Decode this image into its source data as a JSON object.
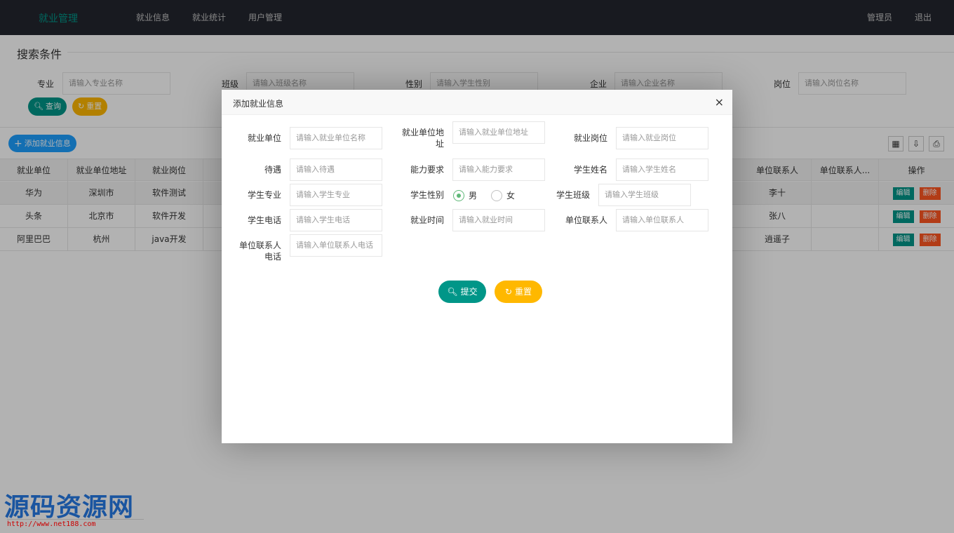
{
  "header": {
    "logo": "就业管理",
    "nav": [
      "就业信息",
      "就业统计",
      "用户管理"
    ],
    "right": [
      "管理员",
      "退出"
    ]
  },
  "search": {
    "legend": "搜索条件",
    "fields": [
      {
        "label": "专业",
        "placeholder": "请输入专业名称"
      },
      {
        "label": "班级",
        "placeholder": "请输入班级名称"
      },
      {
        "label": "性别",
        "placeholder": "请输入学生性别"
      },
      {
        "label": "企业",
        "placeholder": "请输入企业名称"
      },
      {
        "label": "岗位",
        "placeholder": "请输入岗位名称"
      }
    ],
    "query_label": "查询",
    "reset_label": "重置"
  },
  "toolbar": {
    "add_label": "添加就业信息"
  },
  "table": {
    "headers_left": [
      "就业单位",
      "就业单位地址",
      "就业岗位"
    ],
    "headers_right": [
      "单位联系人",
      "单位联系人...",
      "操作"
    ],
    "rows": [
      {
        "unit": "华为",
        "address": "深圳市",
        "position": "软件测试",
        "contact": "李十"
      },
      {
        "unit": "头条",
        "address": "北京市",
        "position": "软件开发",
        "contact": "张八"
      },
      {
        "unit": "阿里巴巴",
        "address": "杭州",
        "position": "java开发",
        "contact": "逍遥子"
      }
    ],
    "edit_label": "编辑",
    "delete_label": "删除"
  },
  "modal": {
    "title": "添加就业信息",
    "close": "×",
    "fields": {
      "unit": {
        "label": "就业单位",
        "placeholder": "请输入就业单位名称"
      },
      "address_label_1": "就业单位地",
      "address_label_2": "址",
      "address": {
        "placeholder": "请输入就业单位地址"
      },
      "position": {
        "label": "就业岗位",
        "placeholder": "请输入就业岗位"
      },
      "salary": {
        "label": "待遇",
        "placeholder": "请输入待遇"
      },
      "ability": {
        "label": "能力要求",
        "placeholder": "请输入能力要求"
      },
      "name": {
        "label": "学生姓名",
        "placeholder": "请输入学生姓名"
      },
      "major": {
        "label": "学生专业",
        "placeholder": "请输入学生专业"
      },
      "gender": {
        "label": "学生性别",
        "male": "男",
        "female": "女",
        "selected": "男"
      },
      "cls": {
        "label": "学生班级",
        "placeholder": "请输入学生班级"
      },
      "phone": {
        "label": "学生电话",
        "placeholder": "请输入学生电话"
      },
      "time": {
        "label": "就业时间",
        "placeholder": "请输入就业时间"
      },
      "contact": {
        "label": "单位联系人",
        "placeholder": "请输入单位联系人"
      },
      "contact_phone_label_1": "单位联系人",
      "contact_phone_label_2": "电话",
      "contact_phone": {
        "placeholder": "请输入单位联系人电话"
      }
    },
    "submit_label": "提交",
    "reset_label": "重置"
  },
  "watermark": {
    "title": "源码资源网",
    "url": "http://www.net188.com"
  },
  "colors": {
    "teal": "#009688",
    "yellow": "#ffb800",
    "blue": "#1e9fff",
    "red": "#ff5722",
    "header": "#23262e"
  }
}
